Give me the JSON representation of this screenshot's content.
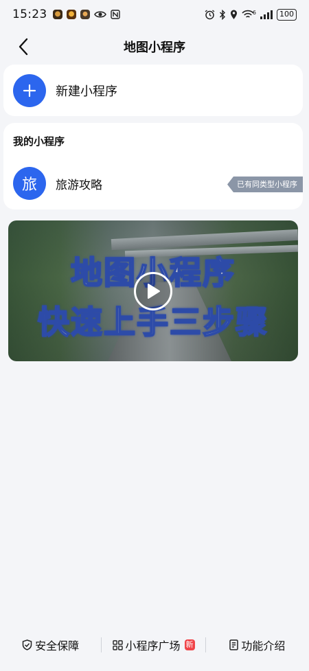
{
  "status_bar": {
    "time": "15:23",
    "battery": "100",
    "network": "6"
  },
  "header": {
    "title": "地图小程序"
  },
  "new_card": {
    "label": "新建小程序"
  },
  "my_programs": {
    "section_title": "我的小程序",
    "items": [
      {
        "avatar_char": "旅",
        "label": "旅游攻略",
        "tag": "已有同类型小程序"
      }
    ]
  },
  "video": {
    "title_line1": "地图小程序",
    "title_line2": "快速上手三步骤"
  },
  "bottom_bar": {
    "items": [
      {
        "label": "安全保障",
        "icon": "shield-check-icon"
      },
      {
        "label": "小程序广场",
        "icon": "grid-icon",
        "badge": "新"
      },
      {
        "label": "功能介绍",
        "icon": "document-icon"
      }
    ]
  },
  "colors": {
    "accent": "#2c66ee",
    "background": "#f4f5f8",
    "tag_bg": "#8b96a7",
    "badge": "#f0454a"
  }
}
